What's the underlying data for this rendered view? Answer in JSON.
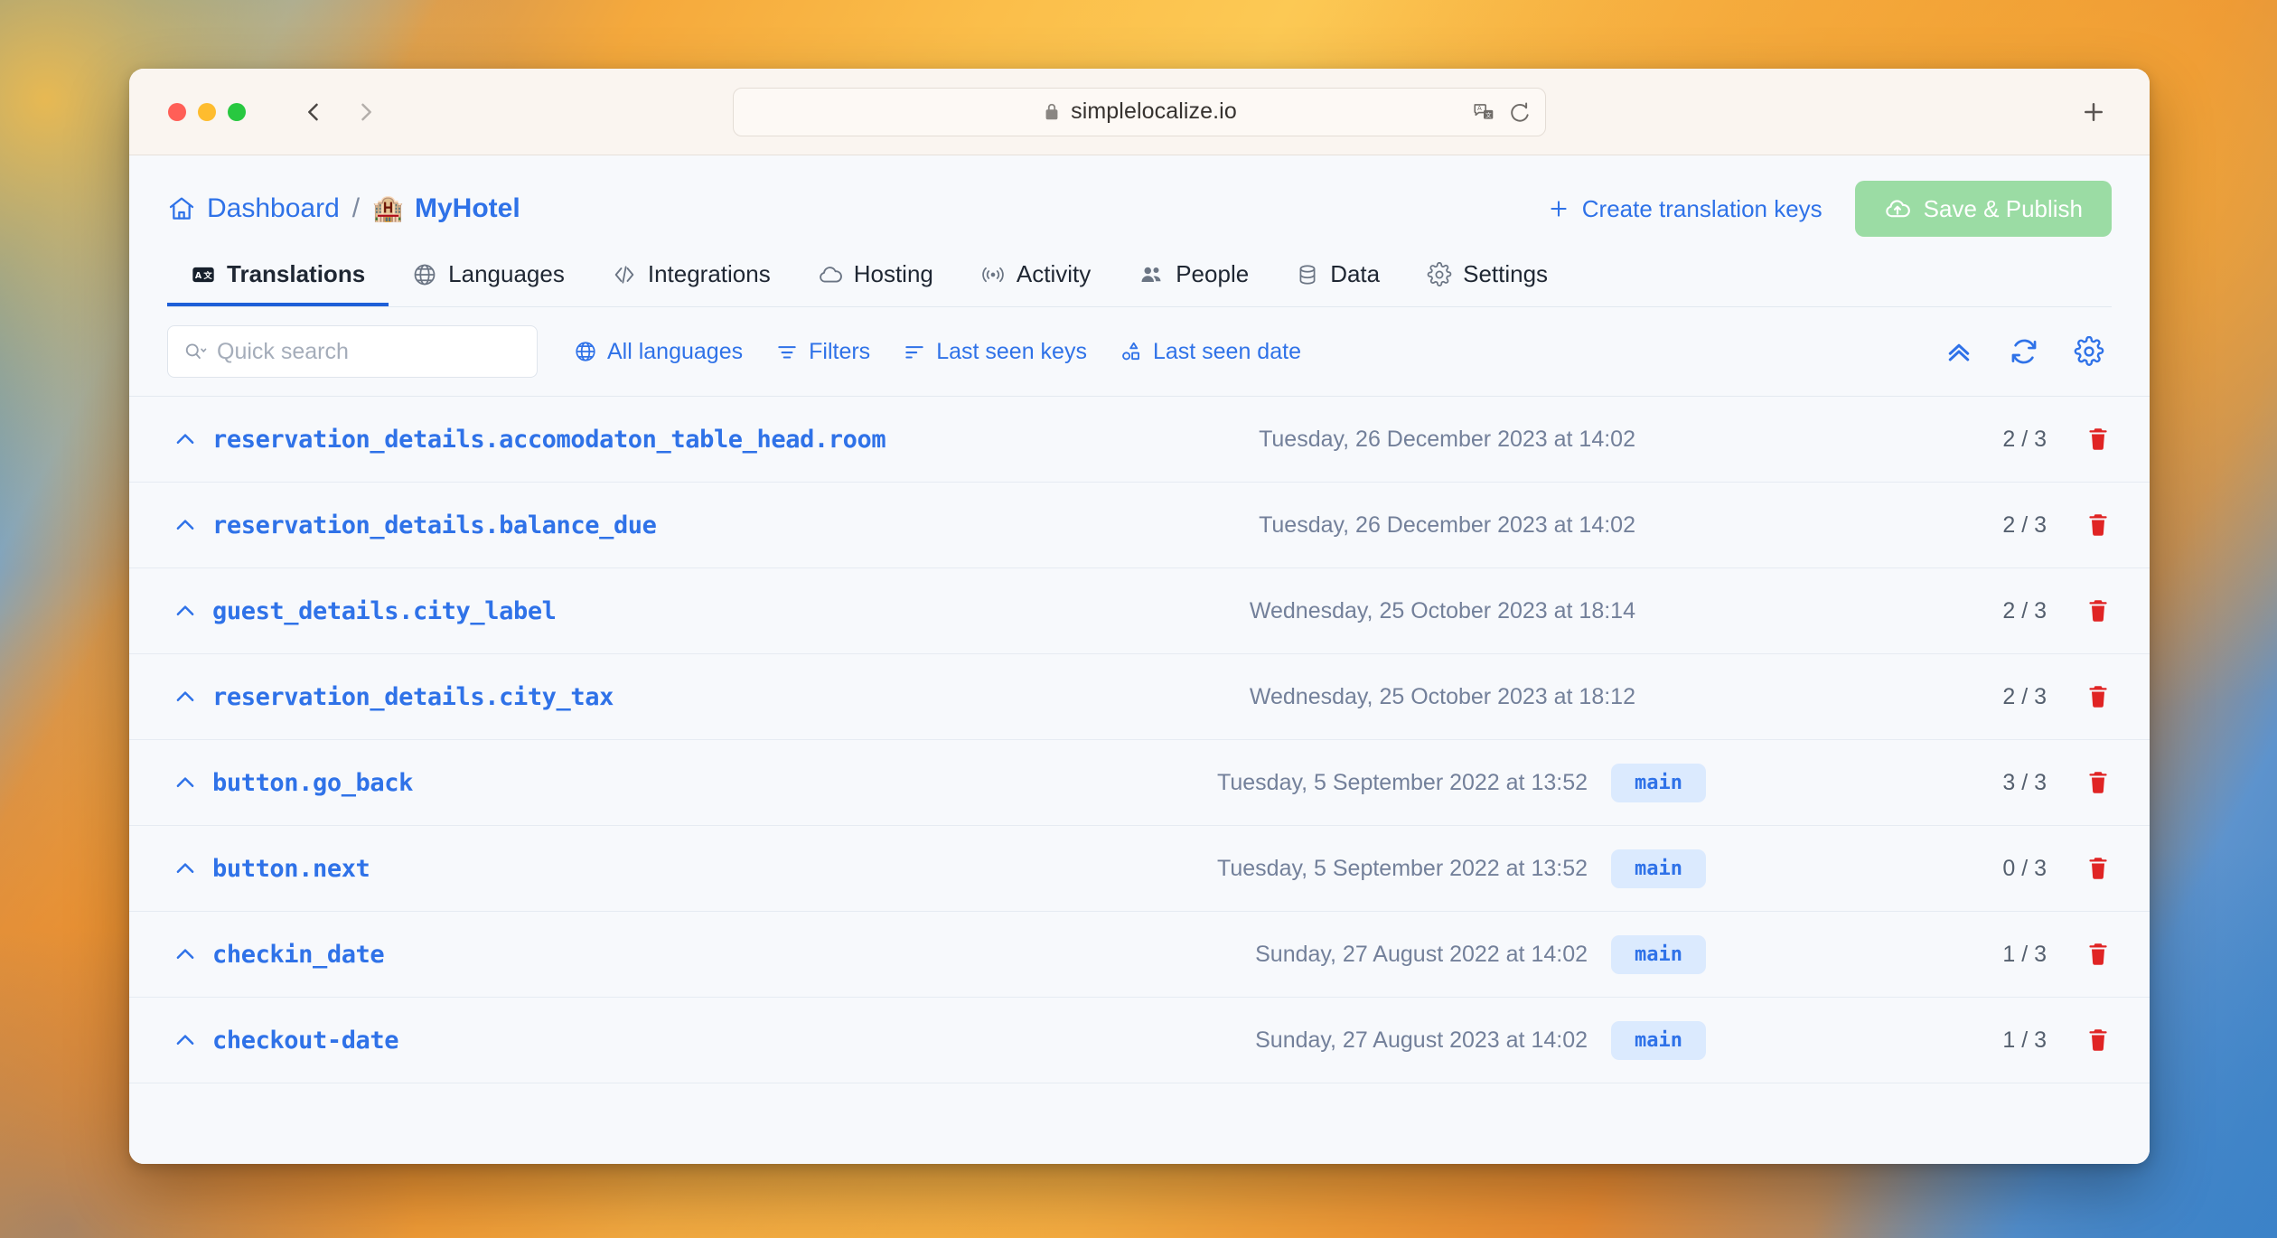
{
  "browser": {
    "url": "simplelocalize.io",
    "lock_icon": "lock-icon",
    "translate_icon": "translate-icon",
    "reload_icon": "reload-icon",
    "back_icon": "back-arrow-icon",
    "forward_icon": "forward-arrow-icon",
    "new_tab_icon": "plus-icon"
  },
  "header": {
    "breadcrumb": {
      "home_icon": "home-icon",
      "dashboard": "Dashboard",
      "separator": "/",
      "project_emoji": "🏨",
      "project": "MyHotel"
    },
    "create_keys_label": "Create translation keys",
    "save_publish_label": "Save & Publish"
  },
  "tabs": [
    {
      "label": "Translations",
      "icon": "translate-box-icon",
      "active": true
    },
    {
      "label": "Languages",
      "icon": "globe-icon",
      "active": false
    },
    {
      "label": "Integrations",
      "icon": "code-icon",
      "active": false
    },
    {
      "label": "Hosting",
      "icon": "cloud-icon",
      "active": false
    },
    {
      "label": "Activity",
      "icon": "broadcast-icon",
      "active": false
    },
    {
      "label": "People",
      "icon": "people-icon",
      "active": false
    },
    {
      "label": "Data",
      "icon": "database-icon",
      "active": false
    },
    {
      "label": "Settings",
      "icon": "gear-icon",
      "active": false
    }
  ],
  "toolbar": {
    "search_placeholder": "Quick search",
    "search_value": "",
    "all_languages_label": "All languages",
    "filters_label": "Filters",
    "last_seen_keys_label": "Last seen keys",
    "last_seen_date_label": "Last seen date",
    "collapse_icon": "chevron-double-up-icon",
    "refresh_icon": "refresh-icon",
    "settings_icon": "gear-icon"
  },
  "colors": {
    "accent_blue": "#2f72e8",
    "progress_green": "#11b43f",
    "progress_track": "#ccd5cc",
    "save_button_green": "#9bdca4",
    "badge_bg": "#dbeafe",
    "delete_red": "#e02424"
  },
  "rows": [
    {
      "key": "reservation_details.accomodaton_table_head.room",
      "date": "Tuesday, 26 December 2023 at 14:02",
      "badge": "",
      "translated": 2,
      "total": 3,
      "count": "2 / 3"
    },
    {
      "key": "reservation_details.balance_due",
      "date": "Tuesday, 26 December 2023 at 14:02",
      "badge": "",
      "translated": 2,
      "total": 3,
      "count": "2 / 3"
    },
    {
      "key": "guest_details.city_label",
      "date": "Wednesday, 25 October 2023 at 18:14",
      "badge": "",
      "translated": 2,
      "total": 3,
      "count": "2 / 3"
    },
    {
      "key": "reservation_details.city_tax",
      "date": "Wednesday, 25 October 2023 at 18:12",
      "badge": "",
      "translated": 2,
      "total": 3,
      "count": "2 / 3"
    },
    {
      "key": "button.go_back",
      "date": "Tuesday, 5 September 2022 at 13:52",
      "badge": "main",
      "translated": 3,
      "total": 3,
      "count": "3 / 3"
    },
    {
      "key": "button.next",
      "date": "Tuesday, 5 September 2022 at 13:52",
      "badge": "main",
      "translated": 0,
      "total": 3,
      "count": "0 / 3"
    },
    {
      "key": "checkin_date",
      "date": "Sunday, 27 August 2022 at 14:02",
      "badge": "main",
      "translated": 1,
      "total": 3,
      "count": "1 / 3"
    },
    {
      "key": "checkout-date",
      "date": "Sunday, 27 August 2023 at 14:02",
      "badge": "main",
      "translated": 1,
      "total": 3,
      "count": "1 / 3"
    }
  ]
}
